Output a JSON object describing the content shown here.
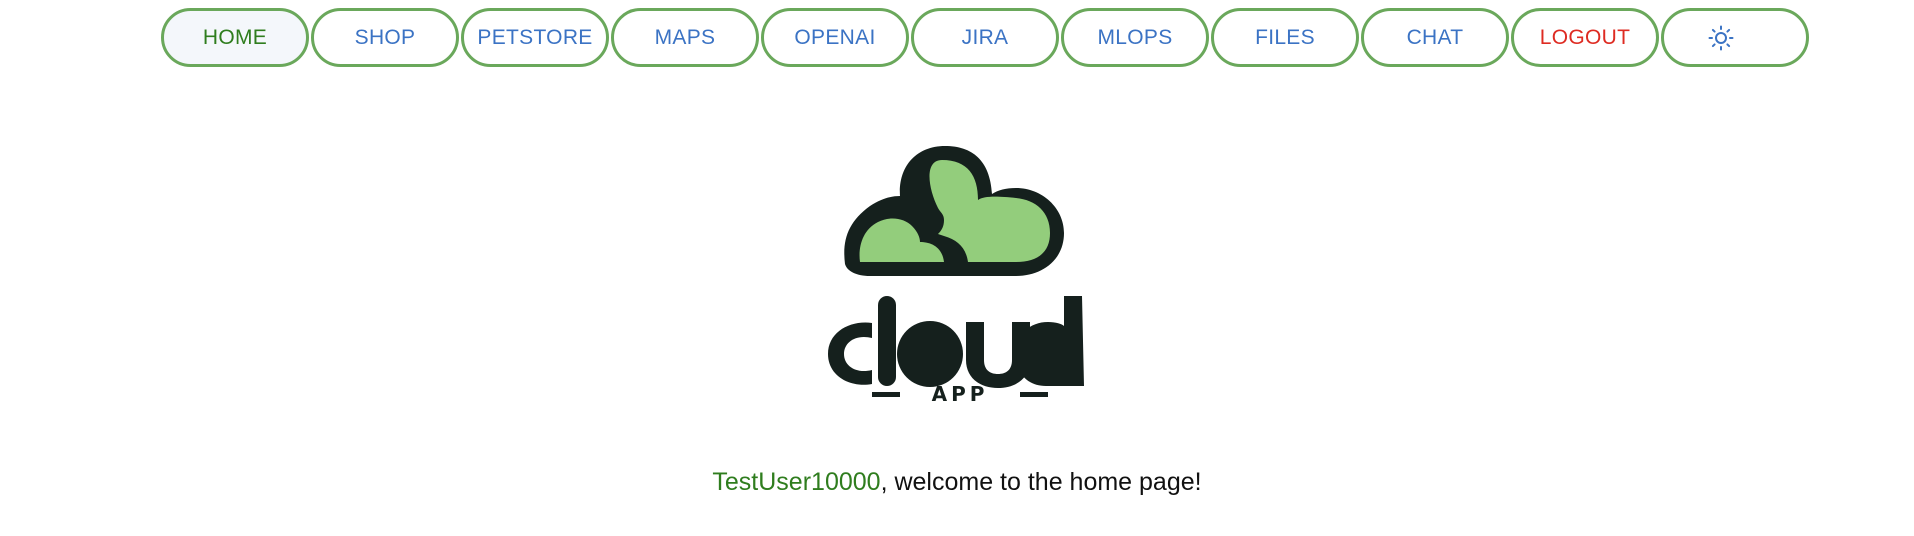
{
  "nav": {
    "items": [
      {
        "label": "HOME",
        "name": "nav-home",
        "state": "active"
      },
      {
        "label": "SHOP",
        "name": "nav-shop"
      },
      {
        "label": "PETSTORE",
        "name": "nav-petstore"
      },
      {
        "label": "MAPS",
        "name": "nav-maps"
      },
      {
        "label": "OPENAI",
        "name": "nav-openai"
      },
      {
        "label": "JIRA",
        "name": "nav-jira"
      },
      {
        "label": "MLOPS",
        "name": "nav-mlops"
      },
      {
        "label": "FILES",
        "name": "nav-files"
      },
      {
        "label": "CHAT",
        "name": "nav-chat"
      },
      {
        "label": "LOGOUT",
        "name": "nav-logout",
        "state": "danger"
      }
    ],
    "theme_toggle_icon": "sun-icon"
  },
  "logo": {
    "wordmark": "cloud",
    "tagline": "APP"
  },
  "welcome": {
    "username": "TestUser10000",
    "message": ", welcome to the home page!"
  },
  "colors": {
    "border_green": "#6aa85b",
    "link_blue": "#3b73c4",
    "active_green": "#2f7d1e",
    "logout_red": "#de2b22",
    "logo_dark": "#15201d",
    "logo_green": "#93cd7c"
  }
}
